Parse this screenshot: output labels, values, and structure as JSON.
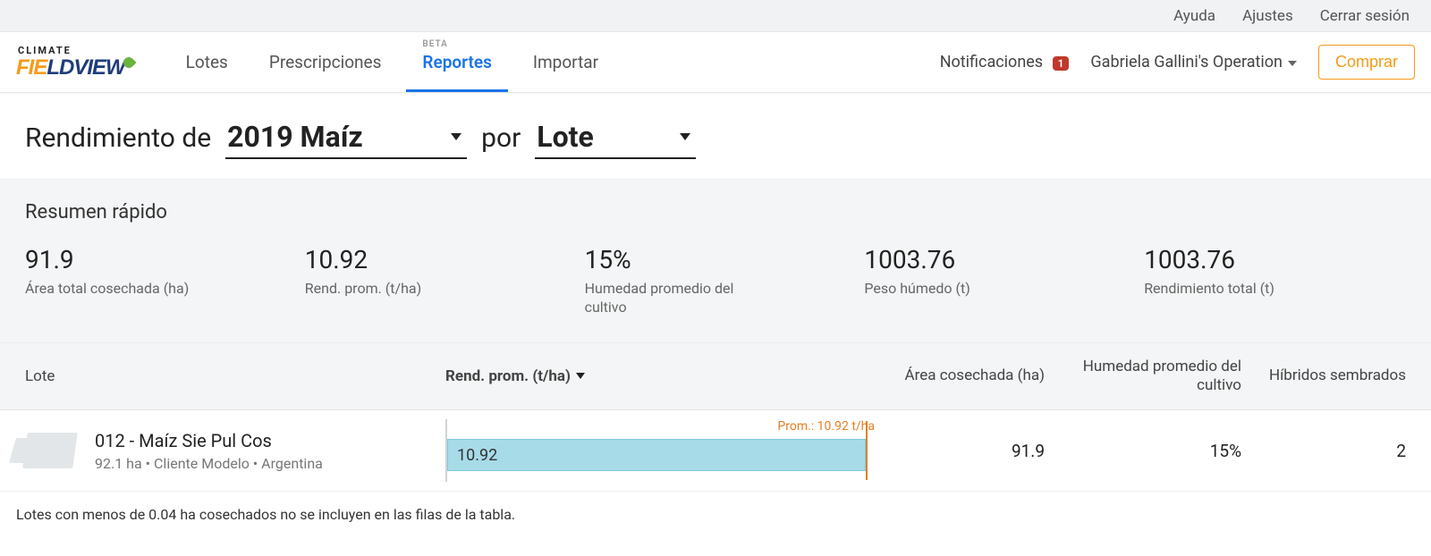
{
  "utility": {
    "help": "Ayuda",
    "settings": "Ajustes",
    "logout": "Cerrar sesión"
  },
  "logo": {
    "top": "CLIMATE",
    "part1": "FIE",
    "part2": "LDVIEW"
  },
  "nav": {
    "lotes": "Lotes",
    "prescripciones": "Prescripciones",
    "reportes_beta": "BETA",
    "reportes": "Reportes",
    "importar": "Importar"
  },
  "nav_right": {
    "notifications_label": "Notificaciones",
    "notifications_count": "1",
    "operation": "Gabriela Gallini's Operation",
    "buy": "Comprar"
  },
  "headline": {
    "prefix": "Rendimiento de",
    "crop_year": "2019 Maíz",
    "by": "por",
    "grouping": "Lote"
  },
  "summary": {
    "title": "Resumen rápido",
    "metrics": [
      {
        "value": "91.9",
        "label": "Área total cosechada (ha)"
      },
      {
        "value": "10.92",
        "label": "Rend. prom. (t/ha)"
      },
      {
        "value": "15%",
        "label": "Humedad promedio del cultivo"
      },
      {
        "value": "1003.76",
        "label": "Peso húmedo (t)"
      },
      {
        "value": "1003.76",
        "label": "Rendimiento total (t)"
      }
    ]
  },
  "table": {
    "headers": {
      "lote": "Lote",
      "rend": "Rend. prom. (t/ha)",
      "area": "Área cosechada (ha)",
      "humedad": "Humedad promedio del cultivo",
      "hibridos": "Híbridos sembrados"
    },
    "avg_label": "Prom.: 10.92 t/ha",
    "rows": [
      {
        "name": "012 - Maíz Sie Pul Cos",
        "sub": "92.1 ha • Cliente Modelo • Argentina",
        "rend": "10.92",
        "area": "91.9",
        "humedad": "15%",
        "hibridos": "2",
        "bar_pct": 98,
        "marker_pct": 98
      }
    ]
  },
  "footnote": "Lotes con menos de 0.04 ha cosechados no se incluyen en las filas de la tabla."
}
